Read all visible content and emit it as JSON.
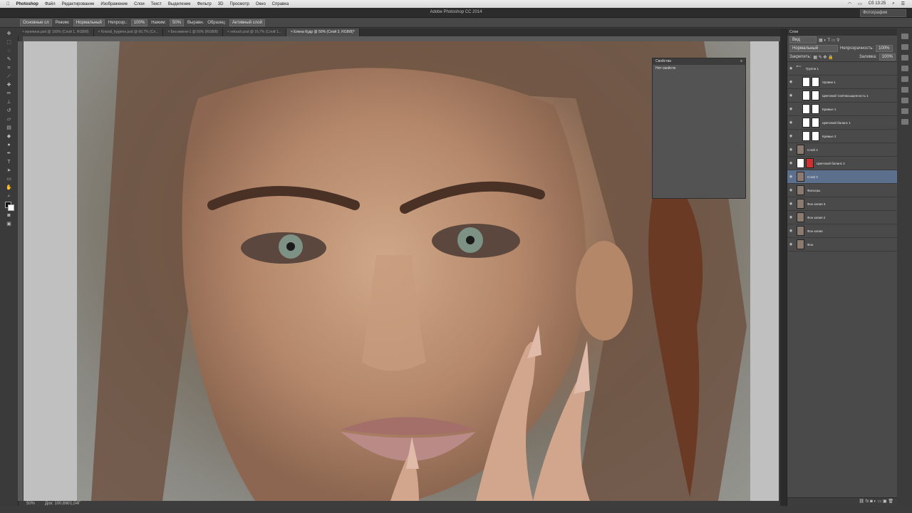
{
  "menubar": {
    "app": "Photoshop",
    "items": [
      "Файл",
      "Редактирование",
      "Изображение",
      "Слои",
      "Текст",
      "Выделение",
      "Фильтр",
      "3D",
      "Просмотр",
      "Окно",
      "Справка"
    ],
    "clock": "Сб 13:25"
  },
  "window": {
    "title": "Adobe Photoshop CC 2014",
    "workspace": "Фотография"
  },
  "options": {
    "preset": "Основные сл",
    "mode_label": "Режим:",
    "mode": "Нормальный",
    "opacity_label": "Непрозр.:",
    "opacity": "100%",
    "flow_label": "Нажим:",
    "flow": "50%",
    "align_label": "Выравн.",
    "sample_label": "Образец:",
    "sample": "Активный слой"
  },
  "tabs": [
    {
      "label": "× мужчина.psd @ 100% (Слой 1, RGB/8)",
      "active": false
    },
    {
      "label": "× Kristall_hygiene.psd @ 66,7% (Сл...",
      "active": false
    },
    {
      "label": "× Без имени-1 @ 50% (RGB/8)",
      "active": false
    },
    {
      "label": "× retouch.psd @ 16,7% (Слой 1...",
      "active": false
    },
    {
      "label": "× Елена Кудр @ 50% (Слой 3, RGB/8)*",
      "active": true
    }
  ],
  "status": {
    "zoom": "50%",
    "doc": "Док: 100,6M/1,04Г"
  },
  "properties": {
    "title": "Свойства",
    "subtitle": "Нет свойств"
  },
  "layers_panel": {
    "title": "Слои",
    "kind": "Вид",
    "blend": "Нормальный",
    "opacity_label": "Непрозрачность:",
    "opacity": "100%",
    "lock_label": "Закрепить:",
    "fill_label": "Заливка:",
    "fill": "100%",
    "layers": [
      {
        "name": "Группа 1",
        "indent": 0,
        "type": "group"
      },
      {
        "name": "Уровни 1",
        "indent": 1,
        "type": "adj"
      },
      {
        "name": "Цветовой тон/Насыщенность 1",
        "indent": 1,
        "type": "adj"
      },
      {
        "name": "Кривые 1",
        "indent": 1,
        "type": "adj"
      },
      {
        "name": "Цветовой баланс 1",
        "indent": 1,
        "type": "adj"
      },
      {
        "name": "Кривые 2",
        "indent": 1,
        "type": "adj"
      },
      {
        "name": "Слой 4",
        "indent": 0,
        "type": "pixel"
      },
      {
        "name": "Цветовой баланс 2",
        "indent": 0,
        "type": "adj-red"
      },
      {
        "name": "Слой 3",
        "indent": 0,
        "type": "pixel",
        "selected": true
      },
      {
        "name": "Фильтры",
        "indent": 0,
        "type": "pixel"
      },
      {
        "name": "Фон копия 3",
        "indent": 0,
        "type": "pixel"
      },
      {
        "name": "Фон копия 2",
        "indent": 0,
        "type": "pixel"
      },
      {
        "name": "Фон копия",
        "indent": 0,
        "type": "pixel"
      },
      {
        "name": "Фон",
        "indent": 0,
        "type": "bg"
      }
    ]
  }
}
